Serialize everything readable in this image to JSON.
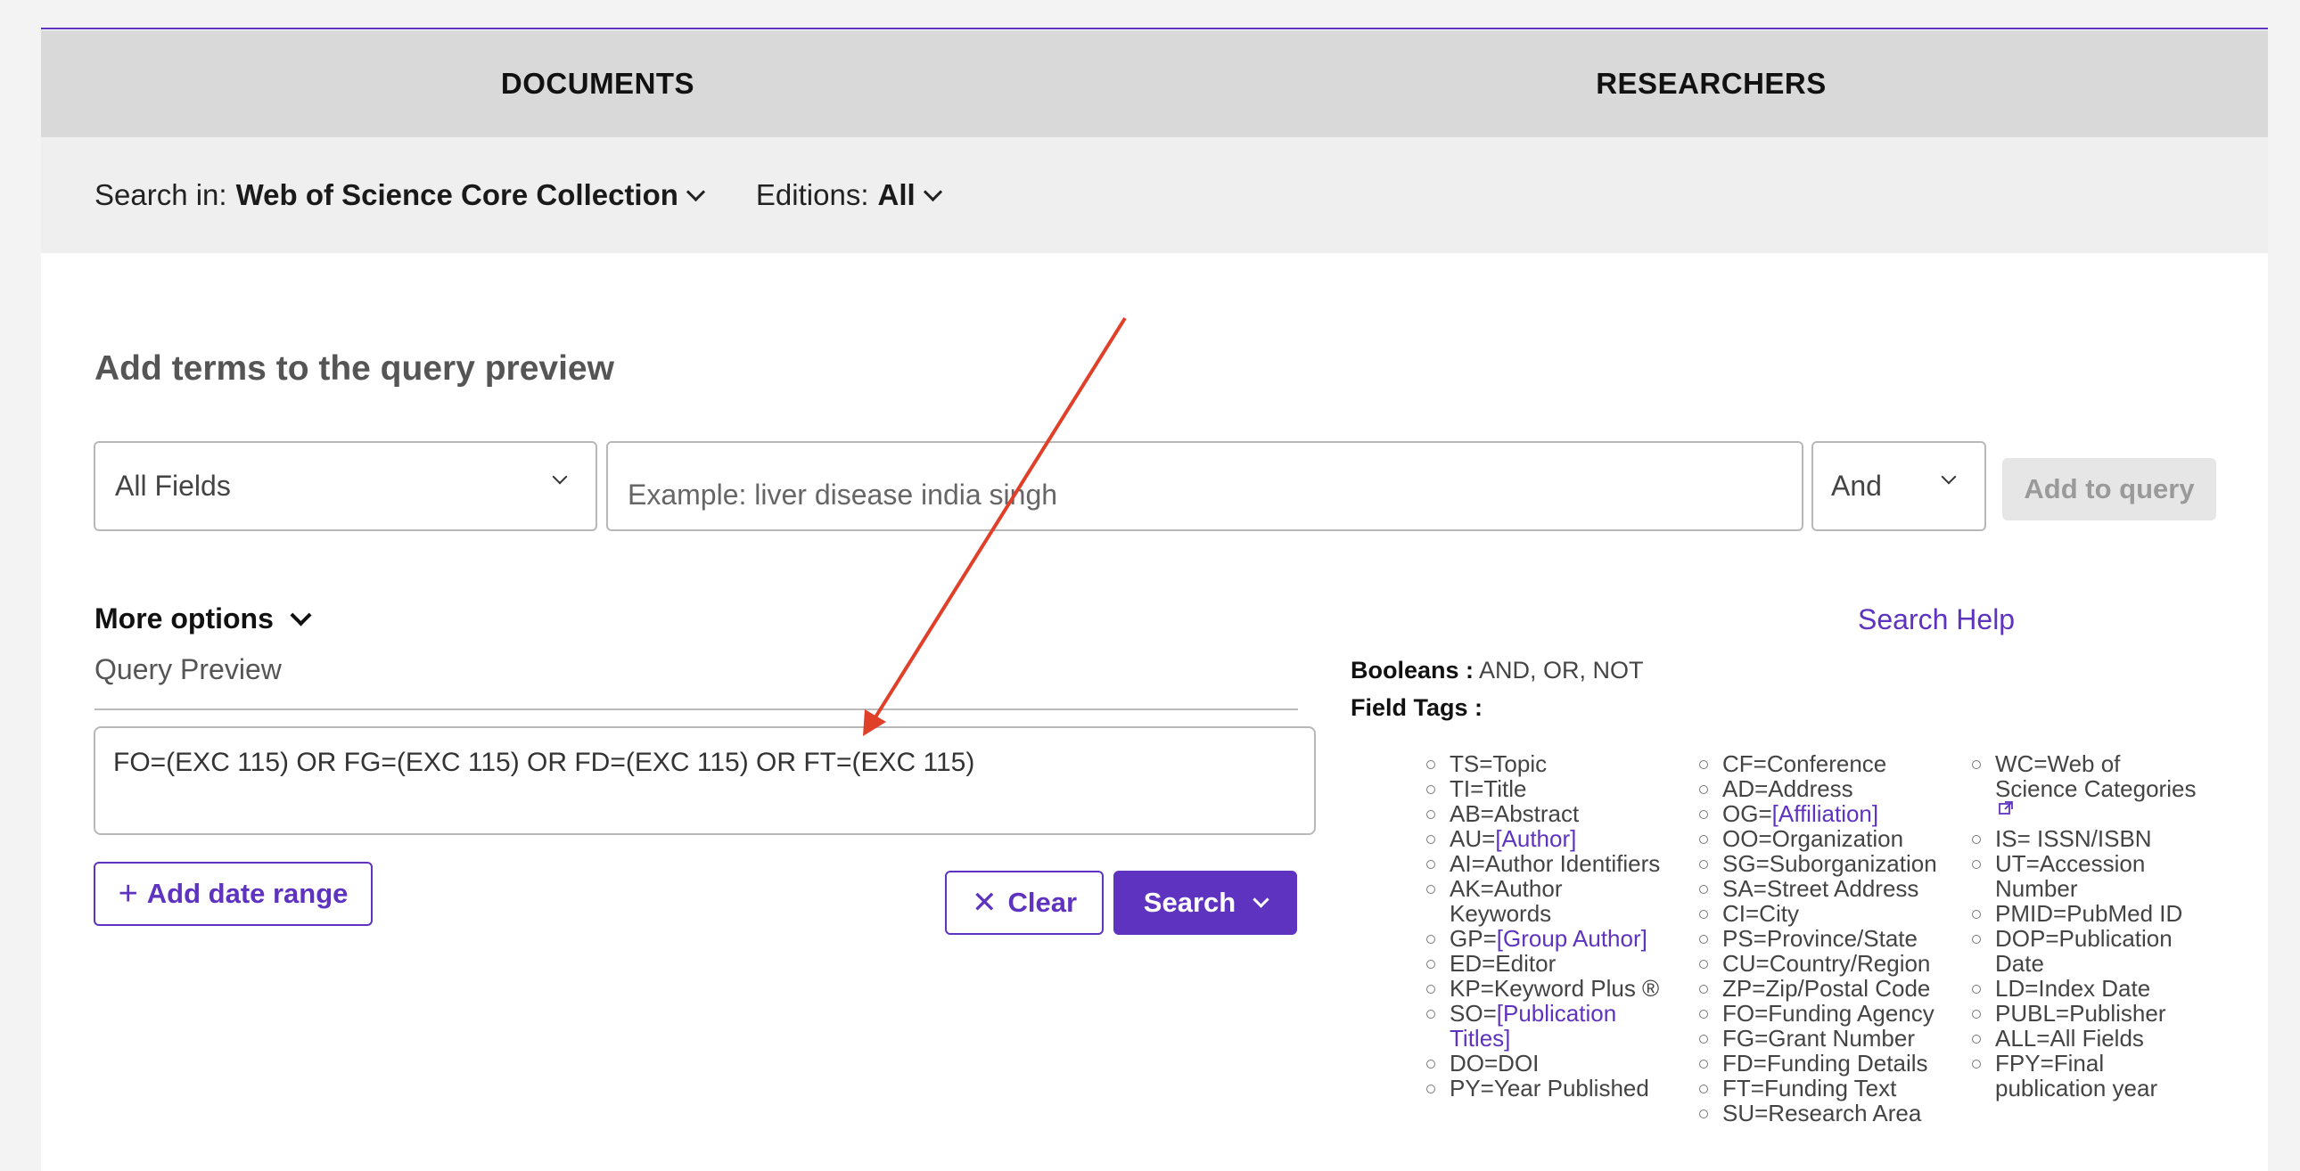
{
  "tabs": {
    "documents": "DOCUMENTS",
    "researchers": "RESEARCHERS"
  },
  "search_in": {
    "label": "Search in:",
    "value": "Web of Science Core Collection",
    "editions_label": "Editions:",
    "editions_value": "All"
  },
  "builder": {
    "heading": "Add terms to the query preview",
    "field_select": "All Fields",
    "term_placeholder": "Example: liver disease india singh",
    "boolean_select": "And",
    "add_to_query": "Add to query"
  },
  "more_options": "More options",
  "query_preview": {
    "label": "Query Preview",
    "value": "FO=(EXC 115) OR FG=(EXC 115) OR FD=(EXC 115) OR FT=(EXC 115)"
  },
  "buttons": {
    "add_date_range": "Add date range",
    "clear": "Clear",
    "search": "Search"
  },
  "help": {
    "search_help": "Search Help",
    "booleans_label": "Booleans :",
    "booleans_value": " AND, OR, NOT",
    "field_tags_label": "Field Tags :"
  },
  "field_tags": {
    "col1": [
      {
        "text": "TS=Topic"
      },
      {
        "text": "TI=Title"
      },
      {
        "text": "AB=Abstract"
      },
      {
        "prefix": "AU=",
        "link": "[Author]"
      },
      {
        "text": "AI=Author Identifiers"
      },
      {
        "text": "AK=Author Keywords"
      },
      {
        "prefix": "GP=",
        "link": "[Group Author]"
      },
      {
        "text": "ED=Editor"
      },
      {
        "text": "KP=Keyword Plus ®"
      },
      {
        "prefix": "SO=",
        "link": "[Publication Titles]"
      },
      {
        "text": "DO=DOI"
      },
      {
        "text": "PY=Year Published"
      }
    ],
    "col2": [
      {
        "text": "CF=Conference"
      },
      {
        "text": "AD=Address"
      },
      {
        "prefix": "OG=",
        "link": "[Affiliation]"
      },
      {
        "text": "OO=Organization"
      },
      {
        "text": "SG=Suborganization"
      },
      {
        "text": "SA=Street Address"
      },
      {
        "text": "CI=City"
      },
      {
        "text": "PS=Province/State"
      },
      {
        "text": "CU=Country/Region"
      },
      {
        "text": "ZP=Zip/Postal Code"
      },
      {
        "text": "FO=Funding Agency"
      },
      {
        "text": "FG=Grant Number"
      },
      {
        "text": "FD=Funding Details"
      },
      {
        "text": "FT=Funding Text"
      },
      {
        "text": "SU=Research Area"
      }
    ],
    "col3": [
      {
        "text": "WC=Web of Science Categories",
        "external": true
      },
      {
        "text": "IS= ISSN/ISBN"
      },
      {
        "text": "UT=Accession Number"
      },
      {
        "text": "PMID=PubMed ID"
      },
      {
        "text": "DOP=Publication Date"
      },
      {
        "text": "LD=Index Date"
      },
      {
        "text": "PUBL=Publisher"
      },
      {
        "text": "ALL=All Fields"
      },
      {
        "text": "FPY=Final publication year"
      }
    ]
  },
  "colors": {
    "accent": "#5e33bf",
    "annotation_arrow": "#e0402a"
  }
}
